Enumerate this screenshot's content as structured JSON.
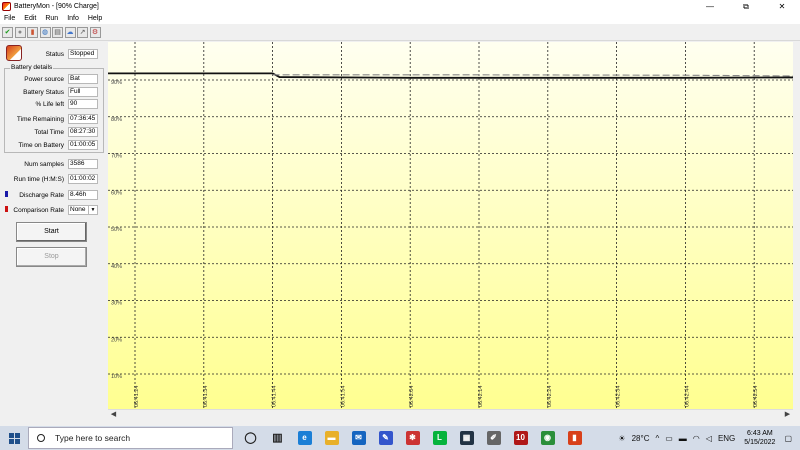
{
  "window": {
    "title": "BatteryMon - [90% Charge]",
    "minimize": "—",
    "maximize": "⧉",
    "close": "✕"
  },
  "menu": [
    "File",
    "Edit",
    "Run",
    "Info",
    "Help"
  ],
  "toolbar": [
    {
      "icon": "check-icon",
      "glyph": "✔"
    },
    {
      "icon": "gray-circle-icon",
      "glyph": "●"
    },
    {
      "icon": "battery-icon",
      "glyph": "▮"
    },
    {
      "icon": "globe-icon",
      "glyph": "◍"
    },
    {
      "icon": "document-icon",
      "glyph": "▤"
    },
    {
      "icon": "cloud-icon",
      "glyph": "☁"
    },
    {
      "icon": "arrow-icon",
      "glyph": "↗"
    },
    {
      "icon": "settings-battery-icon",
      "glyph": "⚙"
    }
  ],
  "sidebar": {
    "status_label": "Status",
    "status_value": "Stopped",
    "group_title": "Battery details",
    "power_source_label": "Power source",
    "power_source_value": "Bat",
    "battery_status_label": "Battery Status",
    "battery_status_value": "Full",
    "life_left_label": "% Life left",
    "life_left_value": "90",
    "time_remaining_label": "Time Remaining",
    "time_remaining_value": "07:36:45",
    "total_time_label": "Total Time",
    "total_time_value": "08:27:30",
    "time_on_battery_label": "Time on Battery",
    "time_on_battery_value": "01:00:05",
    "num_samples_label": "Num samples",
    "num_samples_value": "3586",
    "run_time_label": "Run time (H:M:S)",
    "run_time_value": "01:00:02",
    "discharge_rate_label": "Discharge Rate",
    "discharge_rate_value": "8.46h",
    "discharge_color": "#1a1aa8",
    "comparison_rate_label": "Comparison Rate",
    "comparison_rate_value": "None",
    "comparison_color": "#cc1111",
    "start_label": "Start",
    "stop_label": "Stop"
  },
  "chart_data": {
    "type": "line",
    "background_top": "#fffff0",
    "background_bottom": "#ffff90",
    "y_ticks": [
      "90%",
      "80%",
      "70%",
      "60%",
      "50%",
      "40%",
      "30%",
      "20%",
      "10%"
    ],
    "y_tick_values": [
      90,
      80,
      70,
      60,
      50,
      40,
      30,
      20,
      10
    ],
    "ylim": [
      0,
      100
    ],
    "x_ticks": [
      "06:41:24",
      "06:41:34",
      "06:41:44",
      "06:41:54",
      "06:42:04",
      "06:42:14",
      "06:42:24",
      "06:42:34",
      "06:42:44",
      "06:42:54"
    ],
    "grid": true,
    "series": [
      {
        "style": "solid",
        "color": "#111111",
        "x": [
          0,
          2,
          2.1,
          4,
          6,
          8,
          9.8
        ],
        "y": [
          91.8,
          91.8,
          90.8,
          90.6,
          90.6,
          90.6,
          90.7
        ]
      },
      {
        "style": "dashed",
        "color": "#888888",
        "x": [
          2,
          5,
          8,
          9.8
        ],
        "y": [
          91.4,
          91.4,
          91.3,
          91.1
        ]
      }
    ]
  },
  "taskbar": {
    "search_placeholder": "Type here to search",
    "apps": [
      {
        "icon": "cortana-icon",
        "glyph": "◯",
        "color": "#222"
      },
      {
        "icon": "task-view-icon",
        "glyph": "▥",
        "color": "#222"
      },
      {
        "icon": "edge-icon",
        "glyph": "e",
        "color": "#1b7fd6"
      },
      {
        "icon": "file-explorer-icon",
        "glyph": "▬",
        "color": "#e8b02a"
      },
      {
        "icon": "mail-icon",
        "glyph": "✉",
        "color": "#1565c0"
      },
      {
        "icon": "sketch-app-icon",
        "glyph": "✎",
        "color": "#3355cc"
      },
      {
        "icon": "jetbrains-icon",
        "glyph": "✱",
        "color": "#c33"
      },
      {
        "icon": "line-icon",
        "glyph": "L",
        "color": "#06b33c"
      },
      {
        "icon": "store-icon",
        "glyph": "▦",
        "color": "#234"
      },
      {
        "icon": "utility-icon",
        "glyph": "✐",
        "color": "#666"
      },
      {
        "icon": "app-10-icon",
        "glyph": "10",
        "color": "#b01818"
      },
      {
        "icon": "chrome-icon",
        "glyph": "◉",
        "color": "#2a8f3a"
      },
      {
        "icon": "batterymon-icon",
        "glyph": "▮",
        "color": "#d8401a"
      }
    ],
    "weather": "28°C",
    "language": "ENG",
    "time": "6:43 AM",
    "date": "5/15/2022"
  }
}
